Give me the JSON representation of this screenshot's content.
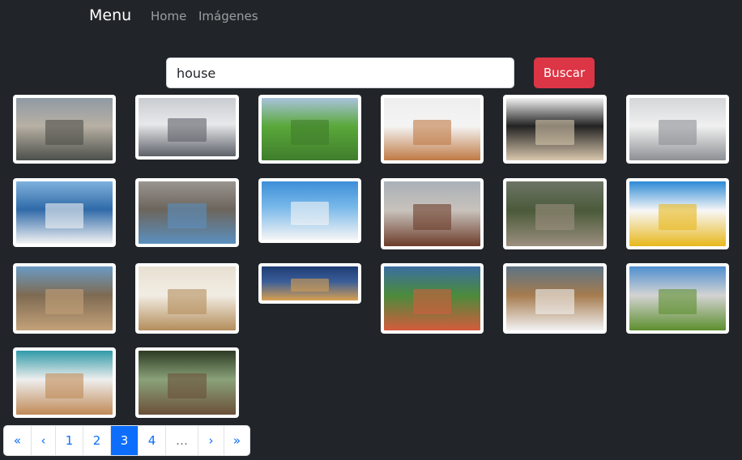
{
  "navbar": {
    "brand": "Menu",
    "links": [
      "Home",
      "Imágenes"
    ]
  },
  "search": {
    "value": "house",
    "button_label": "Buscar"
  },
  "gallery": {
    "images": [
      {
        "name": "haunted-house",
        "colors": [
          "#8f9aa3",
          "#4c4f4a",
          "#b7b0a4"
        ]
      },
      {
        "name": "house-in-clouds",
        "colors": [
          "#c9ccd0",
          "#5d6168",
          "#e7e8ea"
        ]
      },
      {
        "name": "grass-roof-house",
        "colors": [
          "#a9c3dd",
          "#3f7d2c",
          "#5aa83a"
        ]
      },
      {
        "name": "gingerbread-garland",
        "colors": [
          "#eeeeee",
          "#c07a45",
          "#f4f4f4"
        ]
      },
      {
        "name": "modern-interior",
        "colors": [
          "#f2f2f2",
          "#d9c8ae",
          "#222222"
        ]
      },
      {
        "name": "architecture-ceiling",
        "colors": [
          "#d4d6d8",
          "#8d9094",
          "#f0f0f0"
        ]
      },
      {
        "name": "santorini",
        "colors": [
          "#7fb2dd",
          "#f4f4f4",
          "#2f6aa8"
        ]
      },
      {
        "name": "blue-shutter-window",
        "colors": [
          "#9a9590",
          "#5b8fbf",
          "#6c655c"
        ]
      },
      {
        "name": "apartment-facade",
        "colors": [
          "#3d8fd8",
          "#f5f5f5",
          "#7ab9ea"
        ]
      },
      {
        "name": "city-street",
        "colors": [
          "#a9b0b8",
          "#6d3c2a",
          "#c8c2bb"
        ]
      },
      {
        "name": "old-mansion",
        "colors": [
          "#6e7466",
          "#9c8f7e",
          "#4a5a3a"
        ]
      },
      {
        "name": "cube-house",
        "colors": [
          "#2d8ad6",
          "#e8b81c",
          "#f7f7f7"
        ]
      },
      {
        "name": "old-street",
        "colors": [
          "#6a9bc4",
          "#c4a27a",
          "#7e6a52"
        ]
      },
      {
        "name": "empty-room",
        "colors": [
          "#e7e0d2",
          "#b48d5b",
          "#f2ede4"
        ]
      },
      {
        "name": "riverside-panorama",
        "colors": [
          "#1d3c74",
          "#d9a050",
          "#3b5e98"
        ]
      },
      {
        "name": "cinque-terre",
        "colors": [
          "#3b6ea1",
          "#d45b3d",
          "#4b8b3b"
        ]
      },
      {
        "name": "two-windows",
        "colors": [
          "#5d7486",
          "#f2f2f2",
          "#a57b4e"
        ]
      },
      {
        "name": "field-house",
        "colors": [
          "#4e8fd0",
          "#5d8f2e",
          "#d3d3d3"
        ]
      },
      {
        "name": "house-model-keys",
        "colors": [
          "#2f9aa8",
          "#c08a57",
          "#eeeeee"
        ]
      },
      {
        "name": "forest-cabin",
        "colors": [
          "#2d3b24",
          "#6b5038",
          "#8aa27a"
        ]
      }
    ]
  },
  "pagination": {
    "first": "«",
    "prev": "‹",
    "pages": [
      "1",
      "2",
      "3",
      "4"
    ],
    "ellipsis": "…",
    "next": "›",
    "last": "»",
    "active_page": "3"
  }
}
